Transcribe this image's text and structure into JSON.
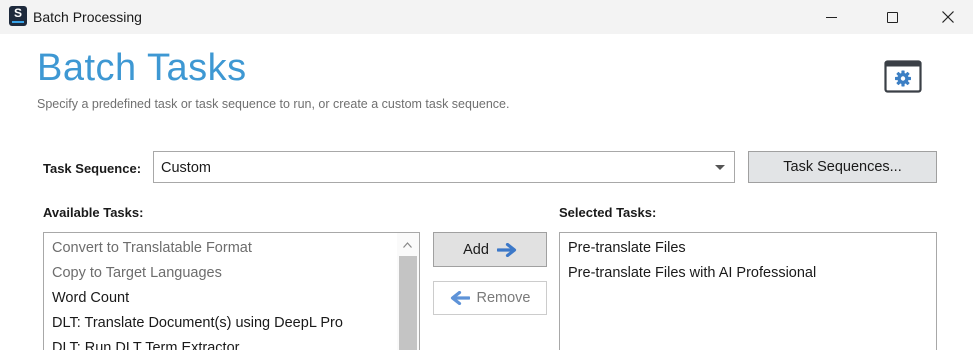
{
  "window": {
    "title": "Batch Processing",
    "app_icon_letter": "S"
  },
  "header": {
    "title": "Batch Tasks",
    "subtitle": "Specify a predefined task or task sequence to run, or create a custom task sequence."
  },
  "task_sequence": {
    "label": "Task Sequence:",
    "selected_value": "Custom",
    "button_label": "Task Sequences..."
  },
  "available_tasks": {
    "label": "Available Tasks:",
    "items": [
      {
        "label": "Convert to Translatable Format",
        "enabled": false
      },
      {
        "label": "Copy to Target Languages",
        "enabled": false
      },
      {
        "label": "Word Count",
        "enabled": true
      },
      {
        "label": "DLT: Translate Document(s) using DeepL Pro",
        "enabled": true
      },
      {
        "label": "DLT: Run DLT Term Extractor",
        "enabled": true
      }
    ]
  },
  "actions": {
    "add_label": "Add",
    "remove_label": "Remove"
  },
  "selected_tasks": {
    "label": "Selected Tasks:",
    "items": [
      {
        "label": "Pre-translate Files"
      },
      {
        "label": "Pre-translate Files with AI Professional"
      }
    ]
  },
  "colors": {
    "accent": "#3e98d3",
    "arrow_blue": "#3c78c8",
    "titlebar_bg": "#f3f3f3"
  }
}
